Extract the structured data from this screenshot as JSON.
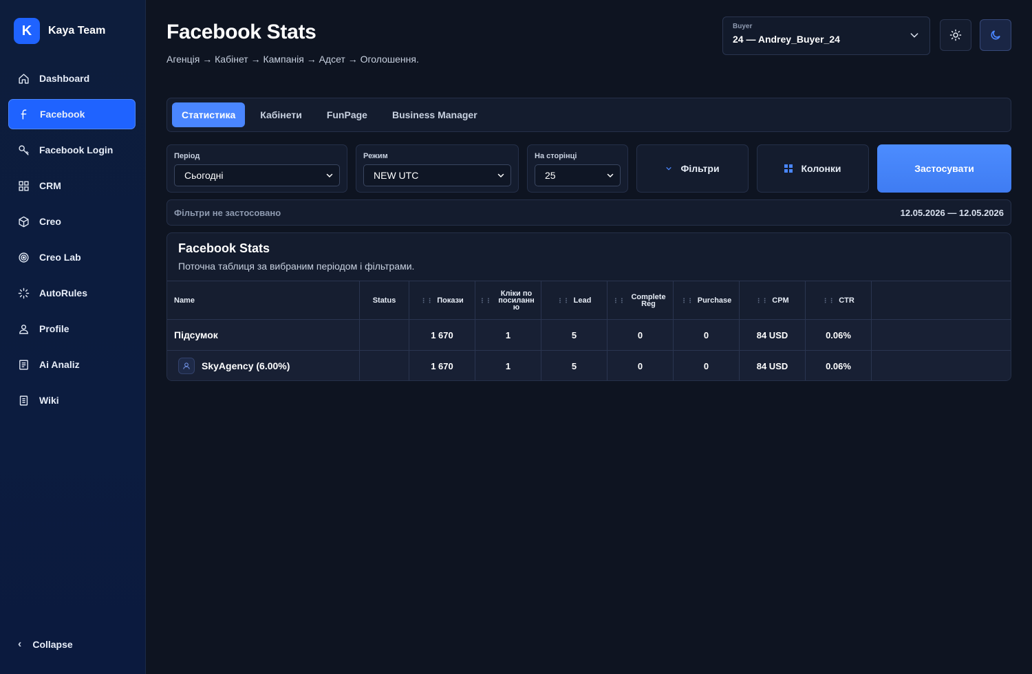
{
  "brand": {
    "logo_letter": "K",
    "name": "Kaya Team"
  },
  "sidebar": {
    "items": [
      {
        "label": "Dashboard",
        "icon": "home-icon"
      },
      {
        "label": "Facebook",
        "icon": "facebook-icon",
        "active": true
      },
      {
        "label": "Facebook Login",
        "icon": "key-icon"
      },
      {
        "label": "CRM",
        "icon": "grid-icon"
      },
      {
        "label": "Creo",
        "icon": "cube-icon"
      },
      {
        "label": "Creo Lab",
        "icon": "target-icon"
      },
      {
        "label": "AutoRules",
        "icon": "sparkle-icon"
      },
      {
        "label": "Profile",
        "icon": "user-icon"
      },
      {
        "label": "Ai Analiz",
        "icon": "document-icon"
      },
      {
        "label": "Wiki",
        "icon": "book-icon"
      }
    ],
    "collapse_label": "Collapse"
  },
  "header": {
    "title": "Facebook Stats",
    "breadcrumb": "Агенція → Кабінет → Кампанія → Адсет → Оголошення.",
    "buyer_label": "Buyer",
    "buyer_value": "24 — Andrey_Buyer_24"
  },
  "tabs": [
    {
      "label": "Статистика",
      "active": true
    },
    {
      "label": "Кабінети"
    },
    {
      "label": "FunPage"
    },
    {
      "label": "Business Manager"
    }
  ],
  "filters": {
    "period": {
      "label": "Період",
      "value": "Сьогодні"
    },
    "mode": {
      "label": "Режим",
      "value": "NEW UTC"
    },
    "per_page": {
      "label": "На сторінці",
      "value": "25"
    },
    "filters_btn": "Фільтри",
    "columns_btn": "Колонки",
    "apply_btn": "Застосувати"
  },
  "status_bar": {
    "left": "Фільтри не застосовано",
    "right": "12.05.2026 — 12.05.2026"
  },
  "card": {
    "title": "Facebook Stats",
    "subtitle": "Поточна таблиця за вибраним періодом і фільтрами."
  },
  "table": {
    "headers": {
      "name": "Name",
      "status": "Status",
      "impressions": "Покази",
      "clicks": "Кліки по посиланн ю",
      "lead": "Lead",
      "complete_reg": "Complete Reg",
      "purchase": "Purchase",
      "cpm": "CPM",
      "ctr": "CTR"
    },
    "rows": [
      {
        "name": "Підсумок",
        "status": "",
        "impressions": "1 670",
        "clicks": "1",
        "lead": "5",
        "complete_reg": "0",
        "purchase": "0",
        "cpm": "84 USD",
        "ctr": "0.06%"
      },
      {
        "name": "SkyAgency (6.00%)",
        "status": "",
        "impressions": "1 670",
        "clicks": "1",
        "lead": "5",
        "complete_reg": "0",
        "purchase": "0",
        "cpm": "84 USD",
        "ctr": "0.06%"
      }
    ]
  },
  "colors": {
    "accent": "#1f63ff",
    "tab_active": "#4a86ff",
    "background": "#0e1421",
    "panel": "#141c2e"
  }
}
